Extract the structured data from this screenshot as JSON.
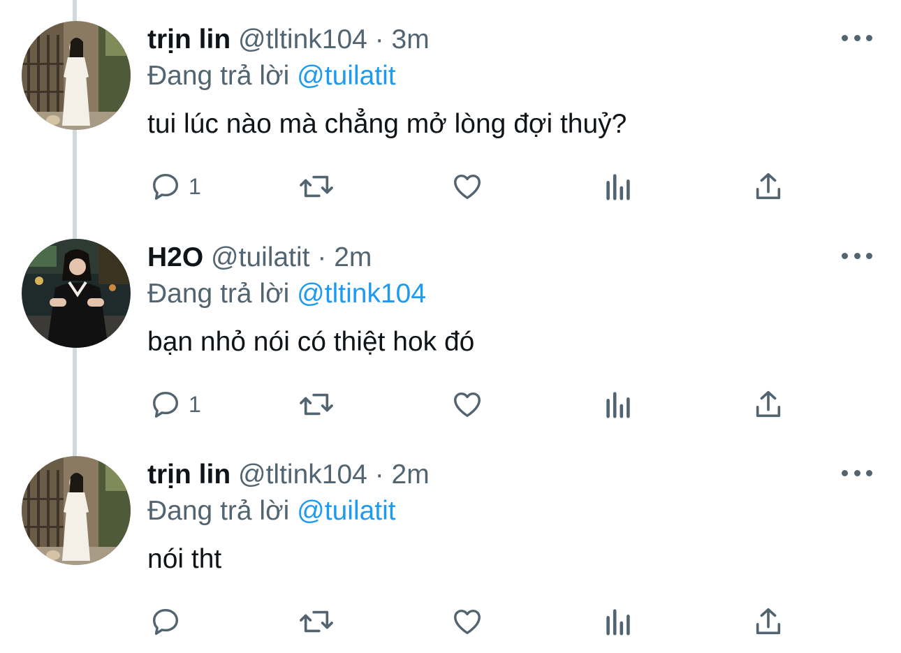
{
  "colors": {
    "text": "#0f1419",
    "secondary": "#536471",
    "accent": "#1d9bf0",
    "thread_line": "#cfd9de"
  },
  "tweets": [
    {
      "name": "trịn lin",
      "handle": "@tltink104",
      "separator": "·",
      "time": "3m",
      "replying_prefix": "Đang trả lời",
      "replying_to": "@tuilatit",
      "text": "tui lúc nào mà chẳng mở lòng đợi thuỷ?",
      "reply_count": "1",
      "avatar_icon": "profile-photo-white-dress"
    },
    {
      "name": "H2O",
      "handle": "@tuilatit",
      "separator": "·",
      "time": "2m",
      "replying_prefix": "Đang trả lời",
      "replying_to": "@tltink104",
      "text": "bạn nhỏ nói có thiệt hok đó",
      "reply_count": "1",
      "avatar_icon": "profile-photo-black-dress"
    },
    {
      "name": "trịn lin",
      "handle": "@tltink104",
      "separator": "·",
      "time": "2m",
      "replying_prefix": "Đang trả lời",
      "replying_to": "@tuilatit",
      "text": "nói tht",
      "reply_count": "",
      "avatar_icon": "profile-photo-white-dress"
    }
  ],
  "action_icons": [
    "reply-icon",
    "retweet-icon",
    "like-icon",
    "views-icon",
    "share-icon"
  ]
}
